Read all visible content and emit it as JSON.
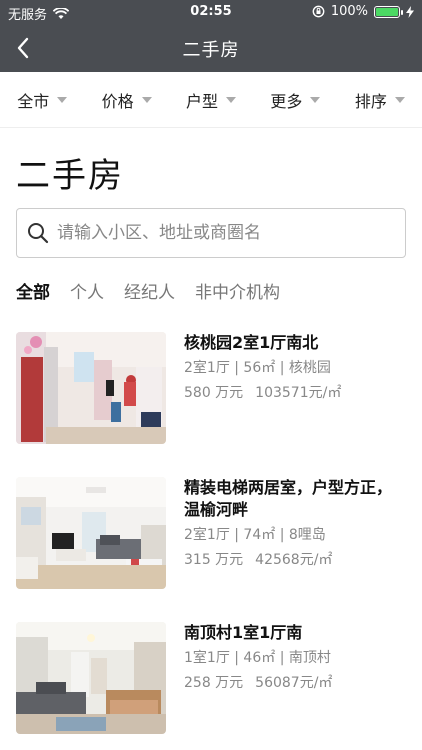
{
  "status": {
    "carrier": "无服务",
    "time": "02:55",
    "battery": "100%",
    "battery_level": 1.0
  },
  "nav": {
    "title": "二手房"
  },
  "filters": [
    "全市",
    "价格",
    "户型",
    "更多",
    "排序"
  ],
  "heading": "二手房",
  "search": {
    "placeholder": "请输入小区、地址或商圈名",
    "value": ""
  },
  "tabs": [
    "全部",
    "个人",
    "经纪人",
    "非中介机构"
  ],
  "listings": [
    {
      "title": "核桃园2室1厅南北",
      "meta": "2室1厅 | 56㎡ | 核桃园",
      "total": "580 万元",
      "unit": "103571元/㎡"
    },
    {
      "title": "精装电梯两居室，户型方正，温榆河畔",
      "meta": "2室1厅 | 74㎡ | 8哩岛",
      "total": "315 万元",
      "unit": "42568元/㎡"
    },
    {
      "title": "南顶村1室1厅南",
      "meta": "1室1厅 | 46㎡ | 南顶村",
      "total": "258 万元",
      "unit": "56087元/㎡"
    }
  ]
}
